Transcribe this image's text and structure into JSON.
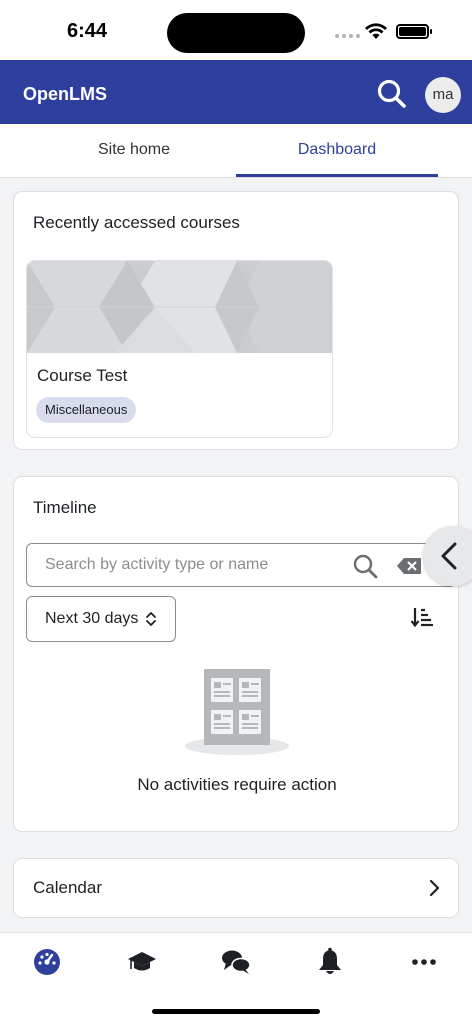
{
  "status_bar": {
    "time": "6:44"
  },
  "app_bar": {
    "title": "OpenLMS",
    "avatar_initials": "ma",
    "search_icon": "search-icon"
  },
  "tabs": [
    {
      "label": "Site home",
      "active": false
    },
    {
      "label": "Dashboard",
      "active": true
    }
  ],
  "recent_courses": {
    "title": "Recently accessed courses",
    "courses": [
      {
        "name": "Course Test",
        "category": "Miscellaneous"
      }
    ]
  },
  "timeline": {
    "title": "Timeline",
    "search": {
      "placeholder": "Search by activity type or name",
      "value": ""
    },
    "filter": {
      "label": "Next 30 days"
    },
    "empty_message": "No activities require action"
  },
  "calendar": {
    "title": "Calendar"
  },
  "bottom_nav": [
    {
      "icon": "dashboard-icon",
      "active": true
    },
    {
      "icon": "graduation-cap-icon",
      "active": false
    },
    {
      "icon": "messages-icon",
      "active": false
    },
    {
      "icon": "bell-icon",
      "active": false
    },
    {
      "icon": "more-icon",
      "active": false
    }
  ],
  "colors": {
    "brand": "#2f3f9e",
    "background": "#f2f3f5",
    "badge": "#d8dcec"
  }
}
